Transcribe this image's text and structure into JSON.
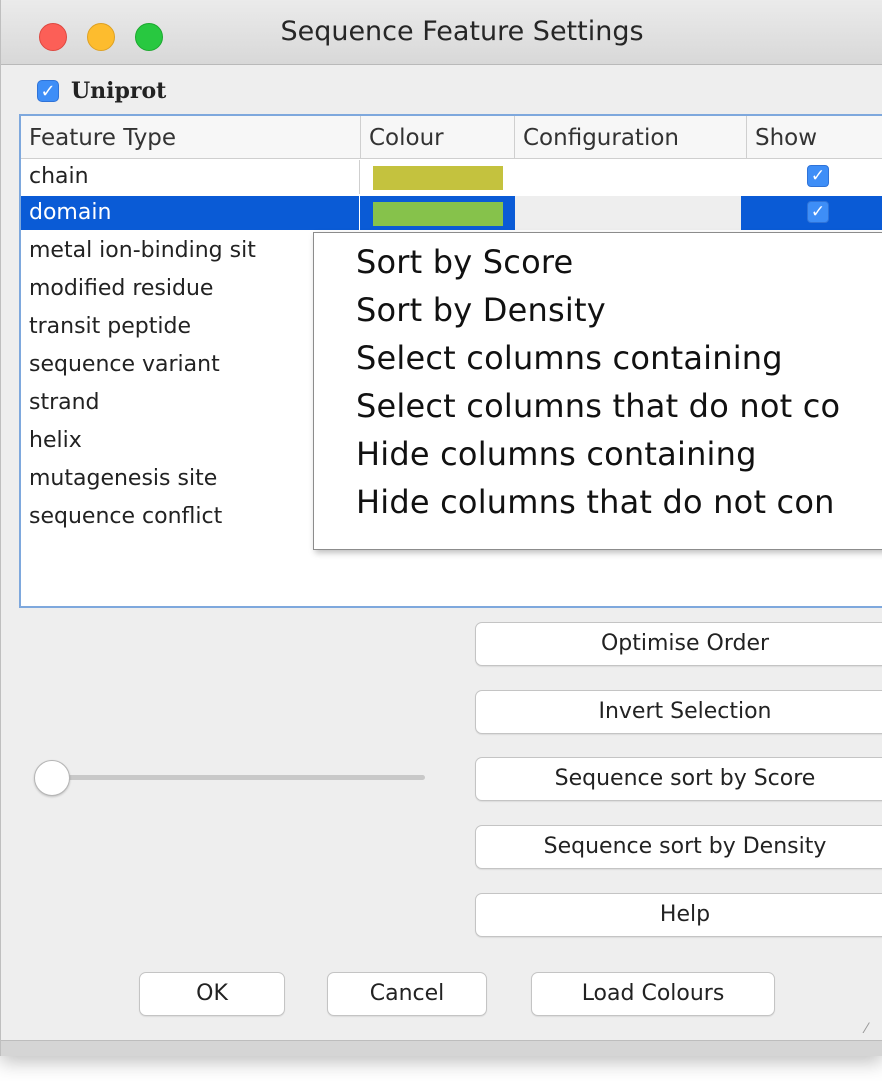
{
  "window": {
    "title": "Sequence Feature Settings"
  },
  "source": {
    "label": "Uniprot",
    "checked": true
  },
  "table": {
    "columns": [
      "Feature Type",
      "Colour",
      "Configuration",
      "Show"
    ],
    "rows": [
      {
        "name": "chain",
        "colour": "#c4c23e",
        "show": true
      },
      {
        "name": "domain",
        "colour": "#86c24b",
        "show": true,
        "selected": true
      },
      {
        "name": "metal ion-binding sit"
      },
      {
        "name": "modified residue"
      },
      {
        "name": "transit peptide"
      },
      {
        "name": "sequence variant"
      },
      {
        "name": "strand"
      },
      {
        "name": "helix"
      },
      {
        "name": "mutagenesis site"
      },
      {
        "name": "sequence conflict"
      }
    ]
  },
  "context_menu": {
    "items": [
      "Sort by Score",
      "Sort by Density",
      "Select columns containing",
      "Select columns that do not co",
      "Hide columns containing",
      "Hide columns that do not con"
    ]
  },
  "buttons": {
    "optimise_order": "Optimise Order",
    "invert_selection": "Invert Selection",
    "sort_by_score": "Sequence sort by Score",
    "sort_by_density": "Sequence sort by Density",
    "help": "Help"
  },
  "footer": {
    "ok": "OK",
    "cancel": "Cancel",
    "load_colours": "Load Colours"
  },
  "slider": {
    "value": 0
  },
  "colors": {
    "selection": "#0a5bd6",
    "checkbox": "#3e8ef7"
  }
}
